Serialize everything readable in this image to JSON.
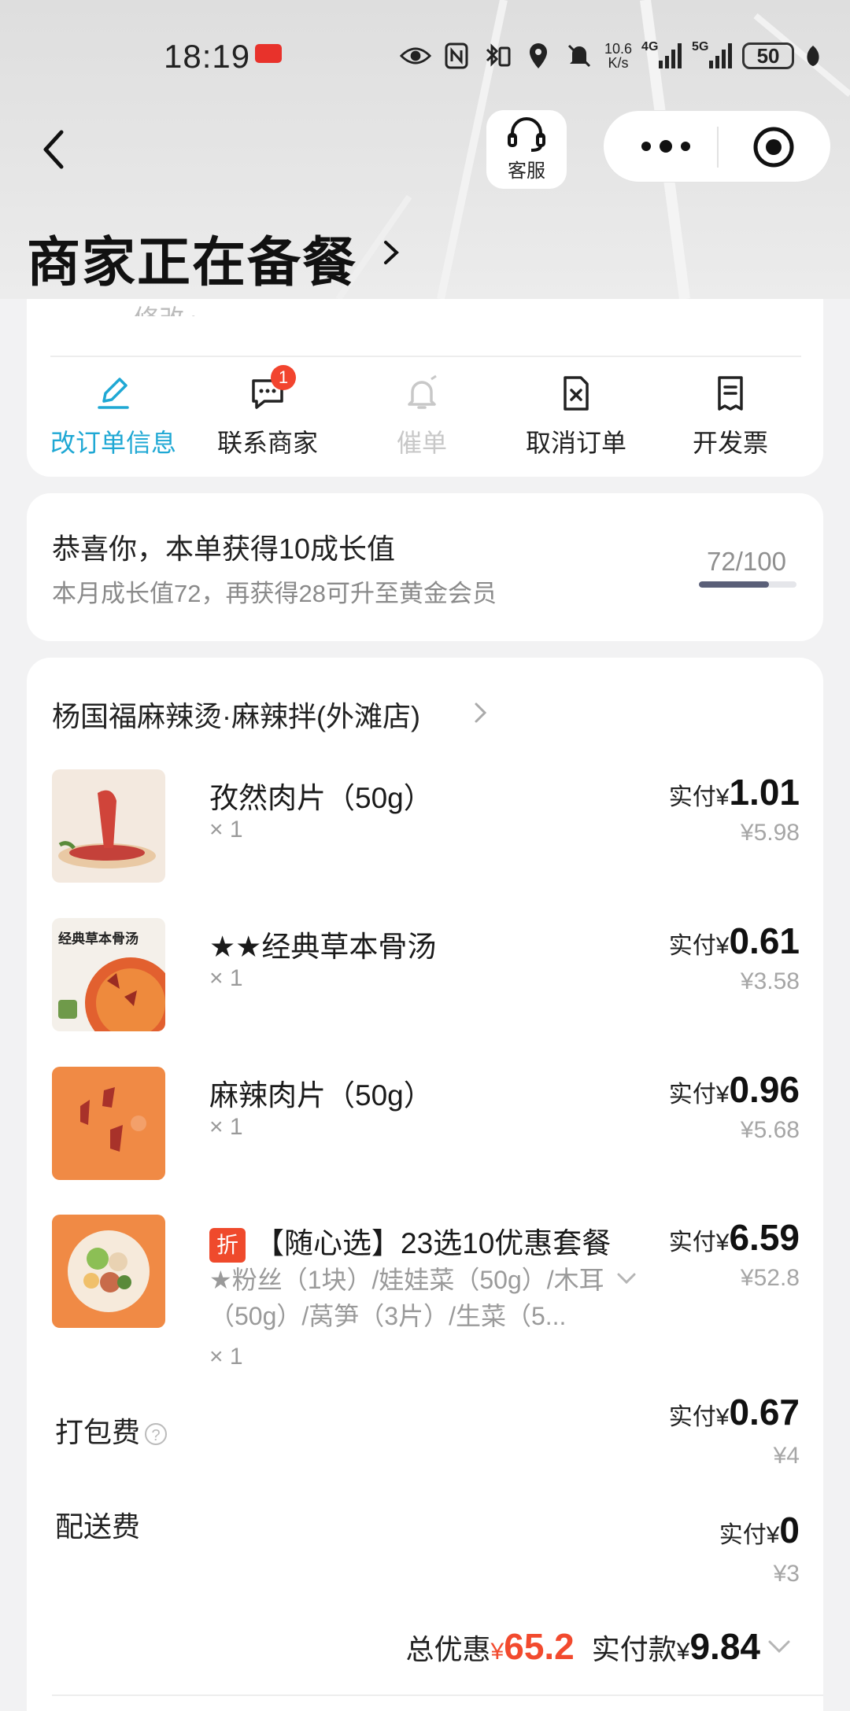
{
  "status_bar": {
    "time": "18:19",
    "network_speed_value": "10.6",
    "network_speed_unit": "K/s",
    "net_4g": "4G",
    "net_5g": "5G",
    "battery": "50"
  },
  "header": {
    "service_label": "客服",
    "title": "商家正在备餐"
  },
  "actions": {
    "partial_text": "修改",
    "items": [
      {
        "label": "改订单信息",
        "icon": "edit-icon"
      },
      {
        "label": "联系商家",
        "icon": "chat-icon",
        "badge": "1"
      },
      {
        "label": "催单",
        "icon": "bell-icon"
      },
      {
        "label": "取消订单",
        "icon": "cancel-order-icon"
      },
      {
        "label": "开发票",
        "icon": "invoice-icon"
      }
    ]
  },
  "growth": {
    "title": "恭喜你，本单获得10成长值",
    "subtitle": "本月成长值72，再获得28可升至黄金会员",
    "progress_text": "72/100",
    "progress_fraction": 0.72
  },
  "order": {
    "shop_name": "杨国福麻辣烫·麻辣拌(外滩店)",
    "pay_label": "实付",
    "currency": "¥",
    "items": [
      {
        "name": "孜然肉片（50g）",
        "qty": "× 1",
        "paid": "1.01",
        "original": "¥5.98"
      },
      {
        "name": "★★经典草本骨汤",
        "qty": "× 1",
        "paid": "0.61",
        "original": "¥3.58",
        "thumb_text": "经典草本骨汤"
      },
      {
        "name": "麻辣肉片（50g）",
        "qty": "× 1",
        "paid": "0.96",
        "original": "¥5.68"
      },
      {
        "name": "【随心选】23选10优惠套餐",
        "tag": "折",
        "desc": "★粉丝（1块）/娃娃菜（50g）/木耳（50g）/莴笋（3片）/生菜（5...",
        "qty": "× 1",
        "paid": "6.59",
        "original": "¥52.8"
      }
    ],
    "packing_fee": {
      "label": "打包费",
      "paid": "0.67",
      "original": "¥4"
    },
    "delivery_fee": {
      "label": "配送费",
      "paid": "0",
      "original": "¥3"
    },
    "total_discount_label": "总优惠",
    "total_discount": "65.2",
    "total_paid_label": "实付款",
    "total_paid": "9.84"
  },
  "colors": {
    "accent_blue": "#1fa8d4",
    "discount_red": "#f24a2e",
    "badge_red": "#f2442e"
  }
}
